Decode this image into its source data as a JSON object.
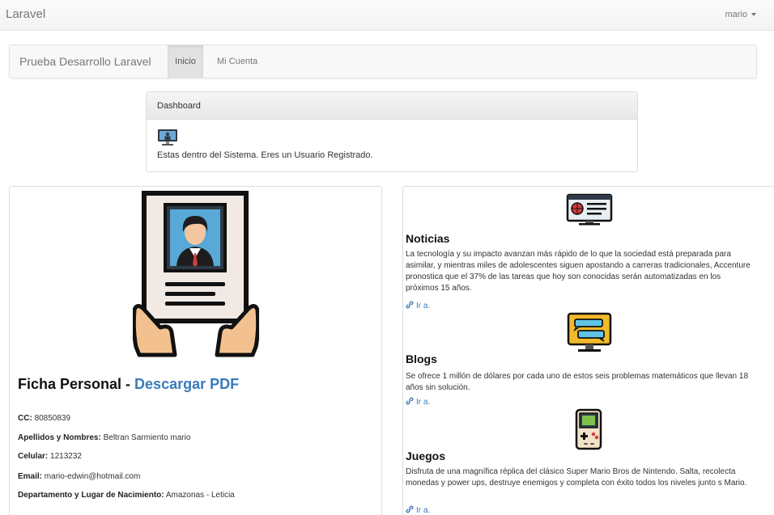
{
  "navbar": {
    "brand": "Laravel",
    "user": "mario"
  },
  "subnav": {
    "brand": "Prueba Desarrollo Laravel",
    "tabs": [
      {
        "label": "Inicio",
        "active": true
      },
      {
        "label": "Mi Cuenta",
        "active": false
      }
    ]
  },
  "dashboard": {
    "heading": "Dashboard",
    "icon": "monitor-icon",
    "message": "Estas dentro del Sistema. Eres un Usuario Registrado."
  },
  "profile": {
    "title": "Ficha Personal - ",
    "download_link": "Descargar PDF",
    "fields": [
      {
        "label": "CC:",
        "value": "80850839"
      },
      {
        "label": "Apellidos y Nombres:",
        "value": "Beltran Sarmiento mario"
      },
      {
        "label": "Celular:",
        "value": "1213232"
      },
      {
        "label": "Email:",
        "value": "mario-edwin@hotmail.com"
      },
      {
        "label": "Departamento y Lugar de Nacimiento:",
        "value": "Amazonas - Leticia"
      }
    ]
  },
  "sections": [
    {
      "icon": "news-icon",
      "title": "Noticias",
      "text": "La tecnología y su impacto avanzan más rápido de lo que la sociedad está preparada para asimilar, y mientras miles de adolescentes siguen apostando a carreras tradicionales, Accenture pronostica que el 37% de las tareas que hoy son conocidas serán automatizadas en los próximos 15 años.",
      "link": "Ir a."
    },
    {
      "icon": "chat-monitor-icon",
      "title": "Blogs",
      "text": "Se ofrece 1 millón de dólares por cada uno de estos seis problemas matemáticos que llevan 18 años sin solución.",
      "link": "Ir a."
    },
    {
      "icon": "gameboy-icon",
      "title": "Juegos",
      "text": "Disfruta de una magnífica réplica del clásico Super Mario Bros de Nintendo. Salta, recolecta monedas y power ups, destruye enemigos y completa con éxito todos los niveles junto s Mario.",
      "link": "Ir a."
    }
  ]
}
